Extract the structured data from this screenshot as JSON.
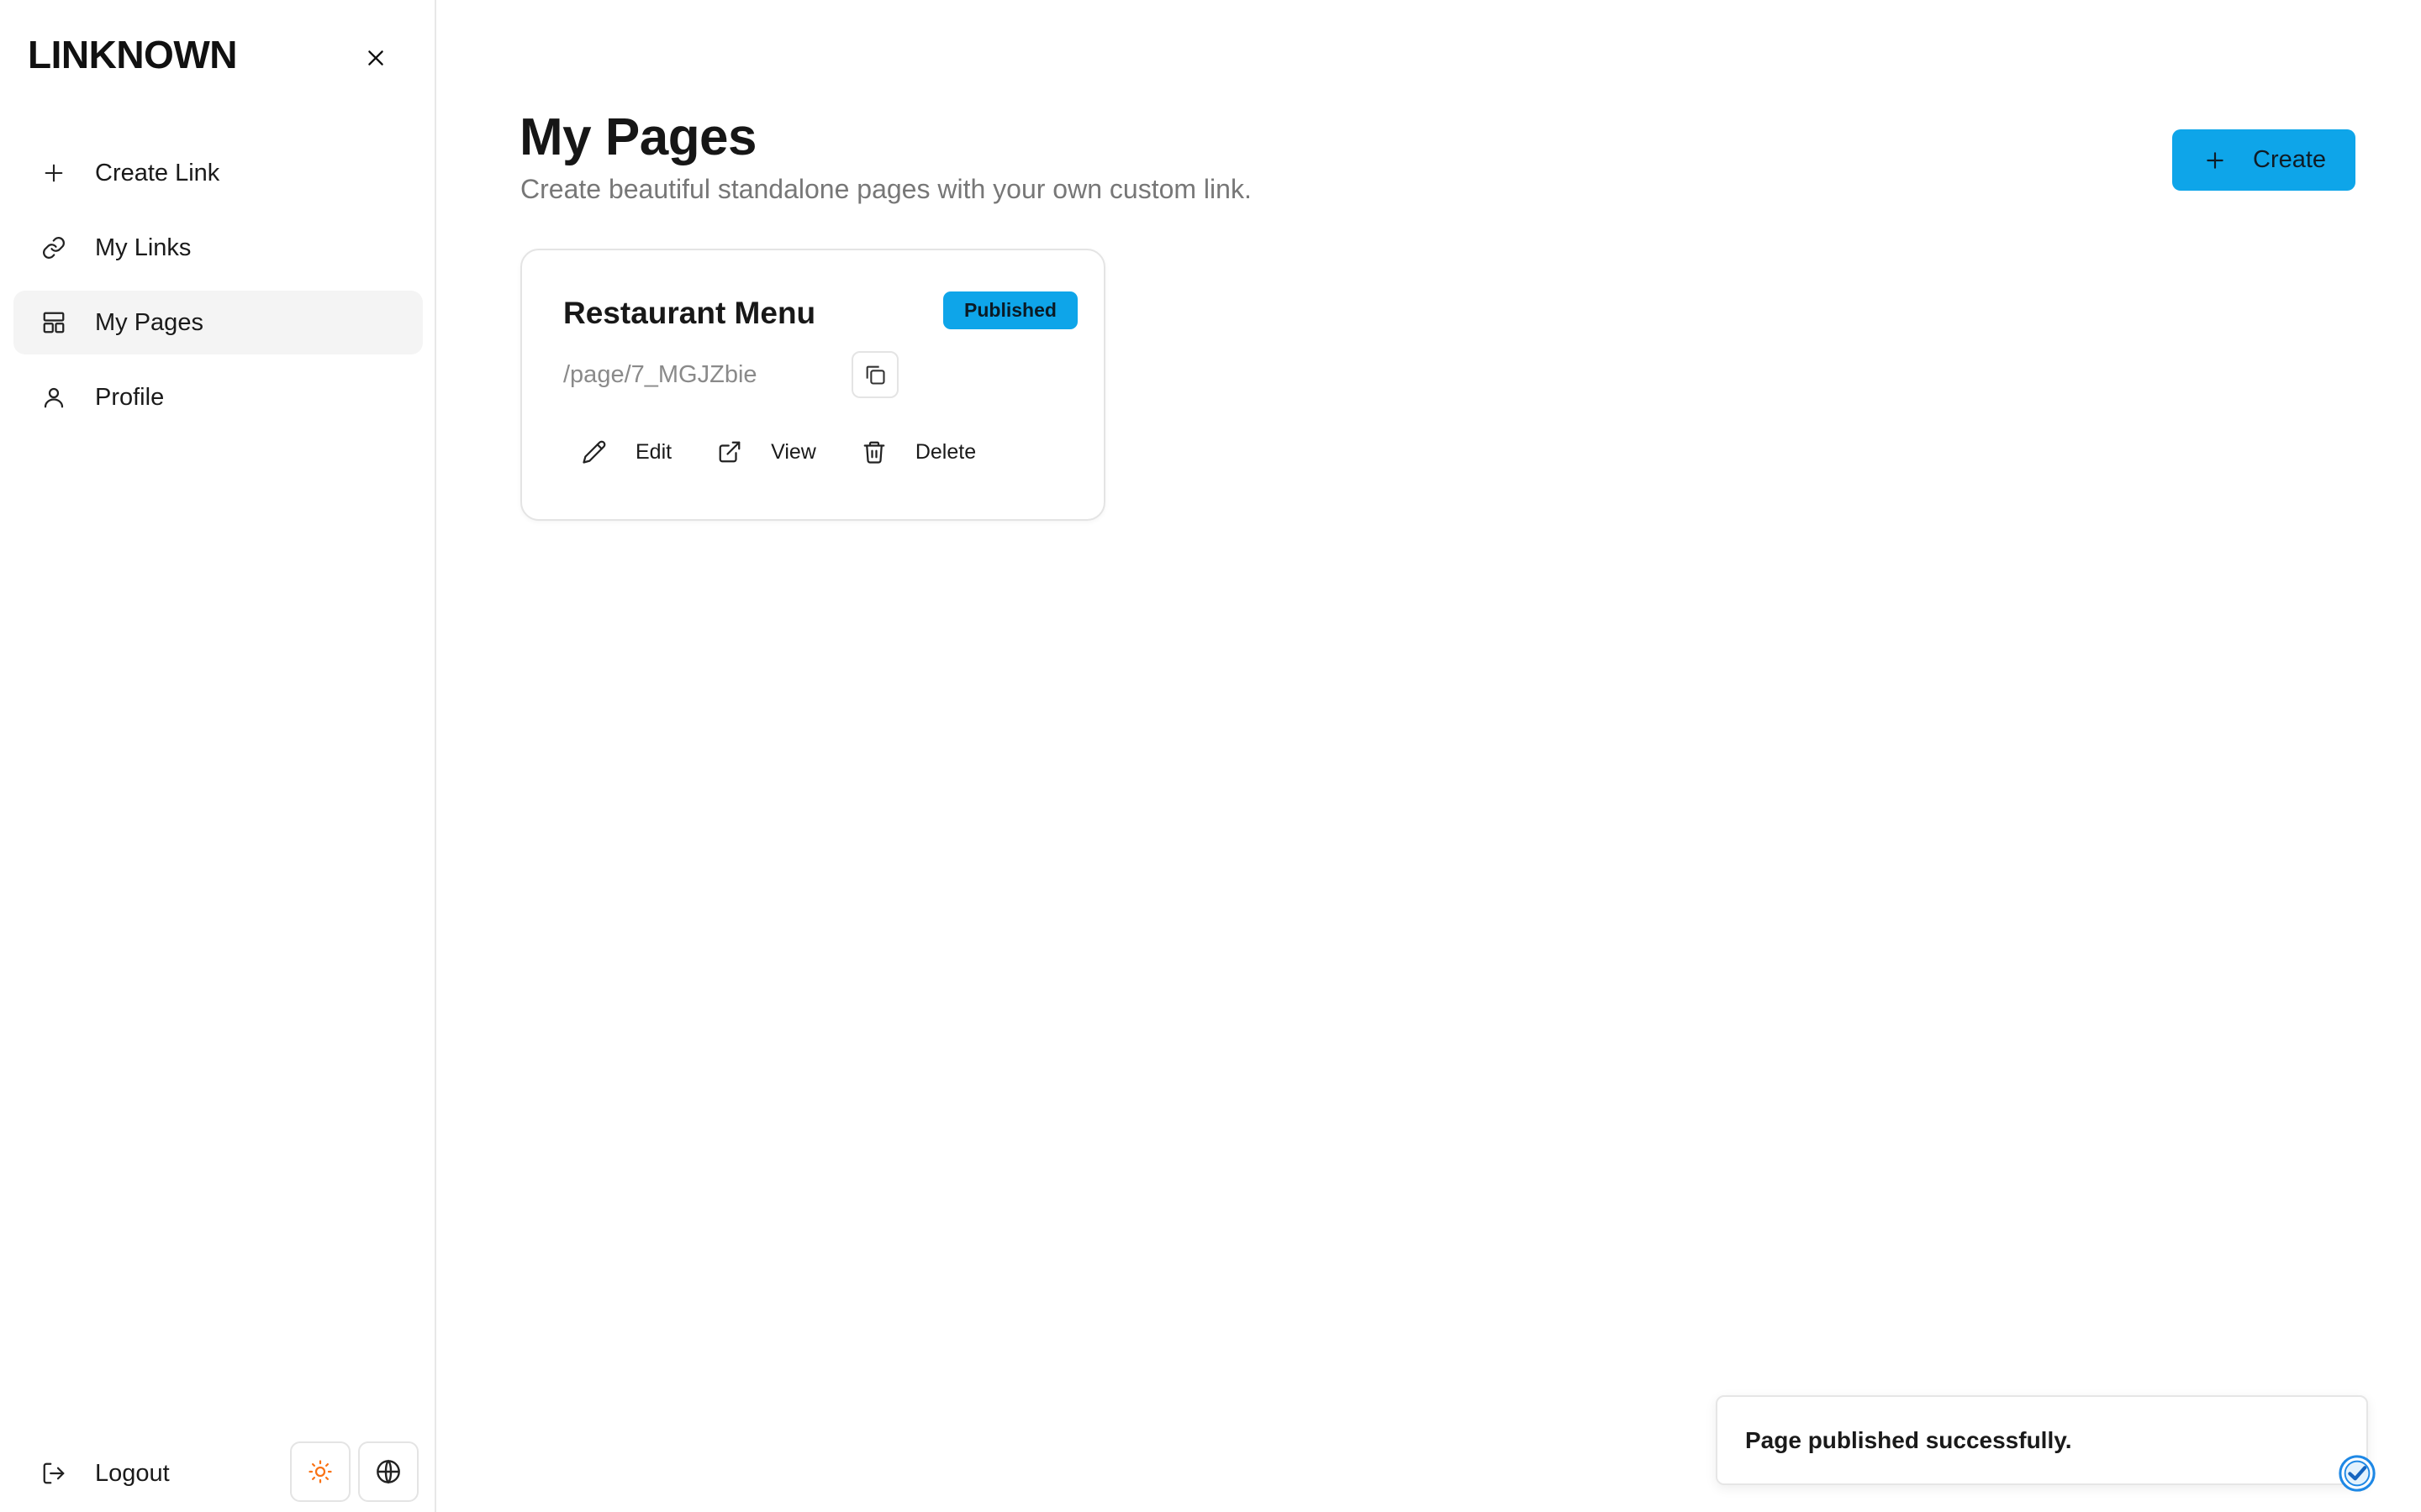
{
  "brand": "LINKNOWN",
  "sidebar": {
    "close_icon": "close-icon",
    "items": [
      {
        "label": "Create Link",
        "icon": "plus-icon",
        "active": false
      },
      {
        "label": "My Links",
        "icon": "link-icon",
        "active": false
      },
      {
        "label": "My Pages",
        "icon": "layout-icon",
        "active": true
      },
      {
        "label": "Profile",
        "icon": "user-icon",
        "active": false
      }
    ],
    "footer": {
      "logout_label": "Logout",
      "logout_icon": "logout-icon",
      "theme_icon": "sun-icon",
      "language_icon": "globe-icon"
    }
  },
  "main": {
    "title": "My Pages",
    "subtitle": "Create beautiful standalone pages with your own custom link.",
    "create_label": "Create"
  },
  "pages": [
    {
      "title": "Restaurant Menu",
      "status": "Published",
      "path": "/page/7_MGJZbie",
      "actions": {
        "edit": "Edit",
        "view": "View",
        "delete": "Delete"
      }
    }
  ],
  "toast": {
    "message": "Page published successfully."
  },
  "colors": {
    "accent": "#0ea5e9",
    "sun": "#f97316",
    "muted_text": "#777777",
    "border": "#e4e4e4"
  }
}
